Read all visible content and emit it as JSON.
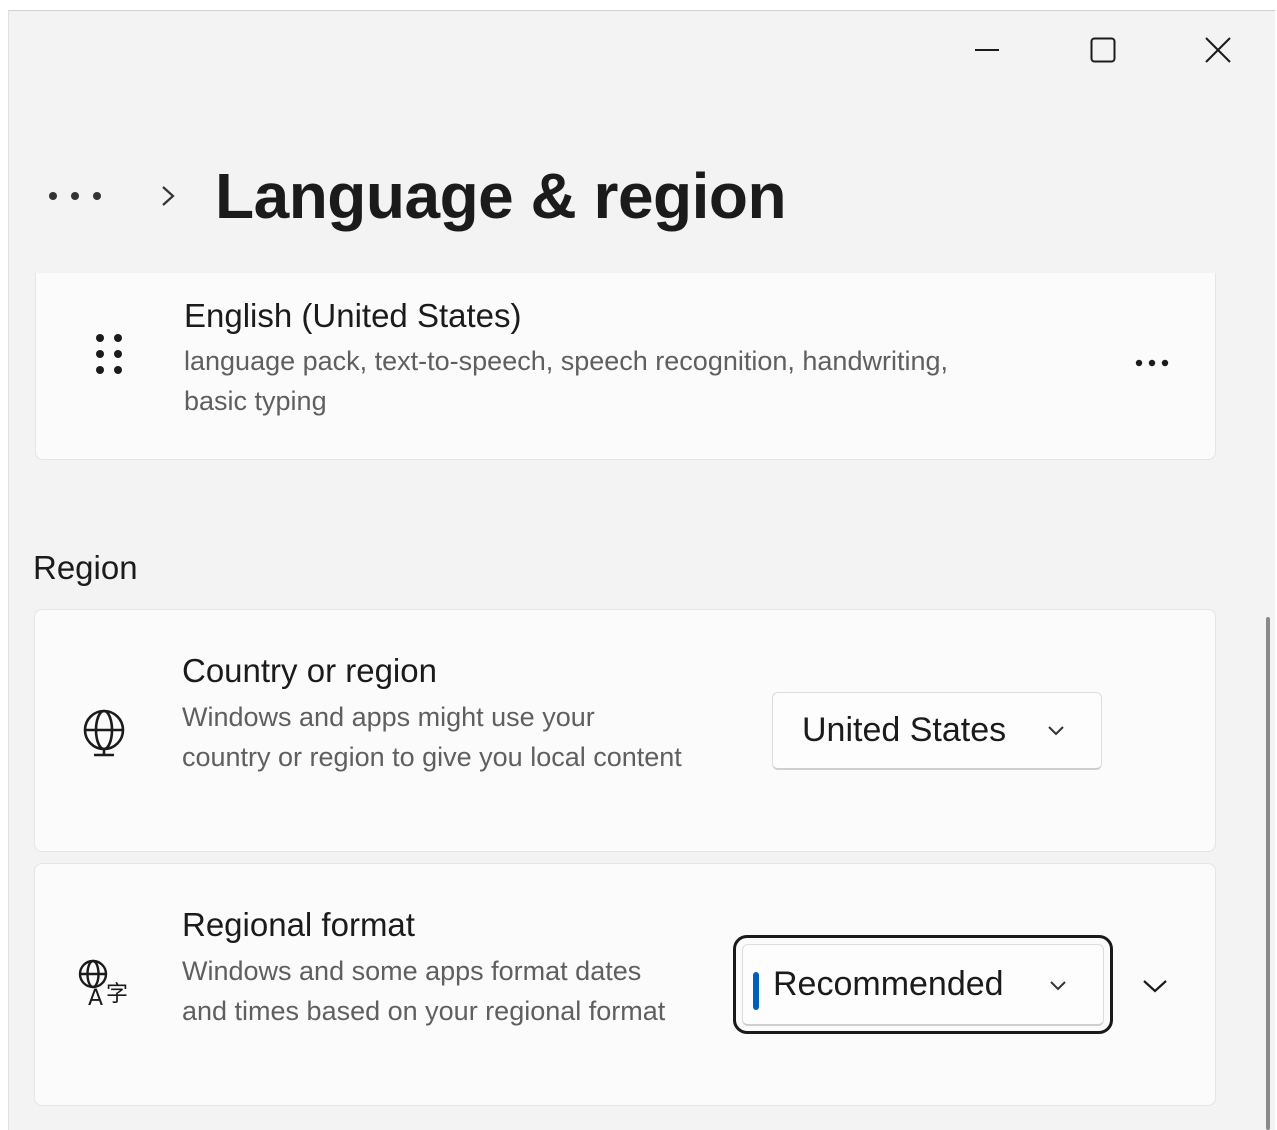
{
  "window": {
    "controls": [
      "minimize",
      "maximize",
      "close"
    ]
  },
  "header": {
    "breadcrumb_more": "...",
    "title": "Language & region"
  },
  "language_item": {
    "name": "English (United States)",
    "features": "language pack, text-to-speech, speech recognition, handwriting, basic typing",
    "icon": "drag-handle-icon",
    "more": "..."
  },
  "region": {
    "heading": "Region",
    "country": {
      "title": "Country or region",
      "description": "Windows and apps might use your country or region to give you local content",
      "icon": "globe-icon",
      "selected": "United States"
    },
    "format": {
      "title": "Regional format",
      "description": "Windows and some apps format dates and times based on your regional format",
      "icon": "regional-format-icon",
      "selected": "Recommended"
    }
  },
  "colors": {
    "accent": "#005fb8",
    "background": "#f3f3f3",
    "card": "#fbfbfb"
  }
}
